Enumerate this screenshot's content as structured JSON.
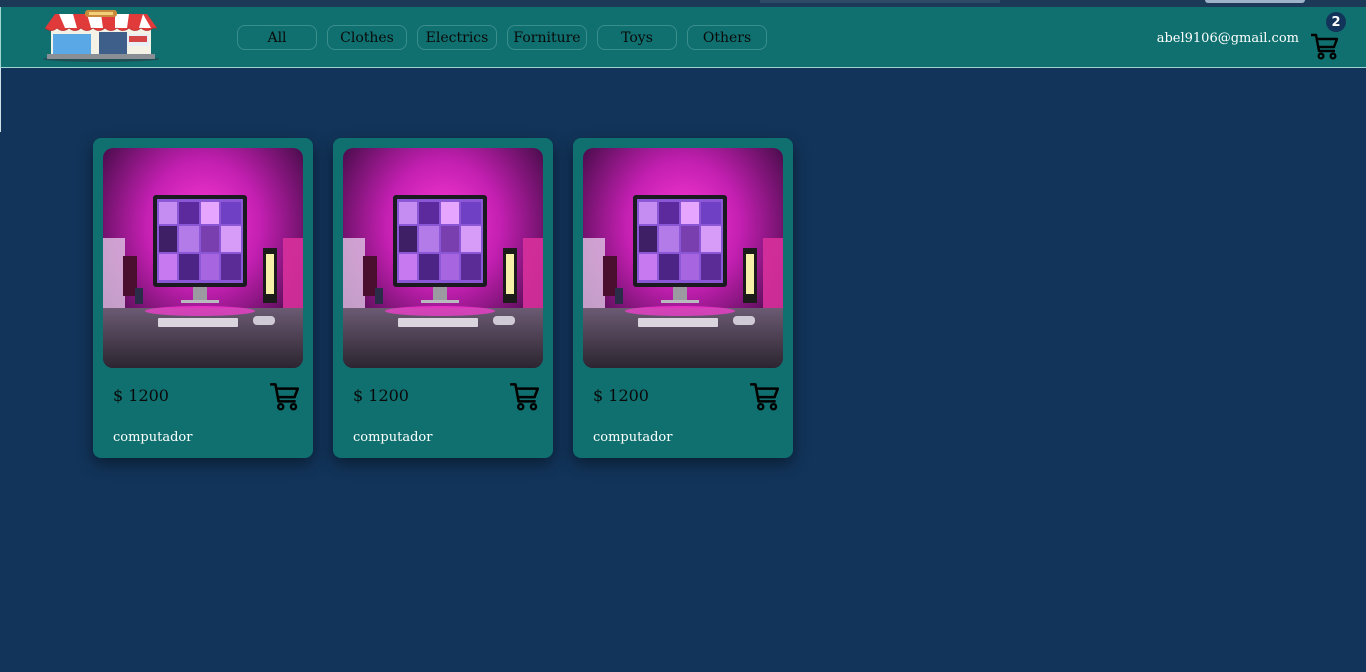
{
  "navbar": {
    "logo_icon": "storefront-logo",
    "categories": [
      "All",
      "Clothes",
      "Electrics",
      "Forniture",
      "Toys",
      "Others"
    ],
    "user_email": "abel9106@gmail.com",
    "cart_icon": "shopping-cart-icon",
    "cart_count": "2"
  },
  "products": [
    {
      "price": "$ 1200",
      "name": "computador",
      "image": "desktop-monitor-pink-lights",
      "cart_icon": "shopping-cart-icon"
    },
    {
      "price": "$ 1200",
      "name": "computador",
      "image": "desktop-monitor-pink-lights",
      "cart_icon": "shopping-cart-icon"
    },
    {
      "price": "$ 1200",
      "name": "computador",
      "image": "desktop-monitor-pink-lights",
      "cart_icon": "shopping-cart-icon"
    }
  ],
  "colors": {
    "background": "#12345a",
    "navbar": "#0f706f",
    "card": "#0f706f",
    "badge": "#12345a"
  }
}
